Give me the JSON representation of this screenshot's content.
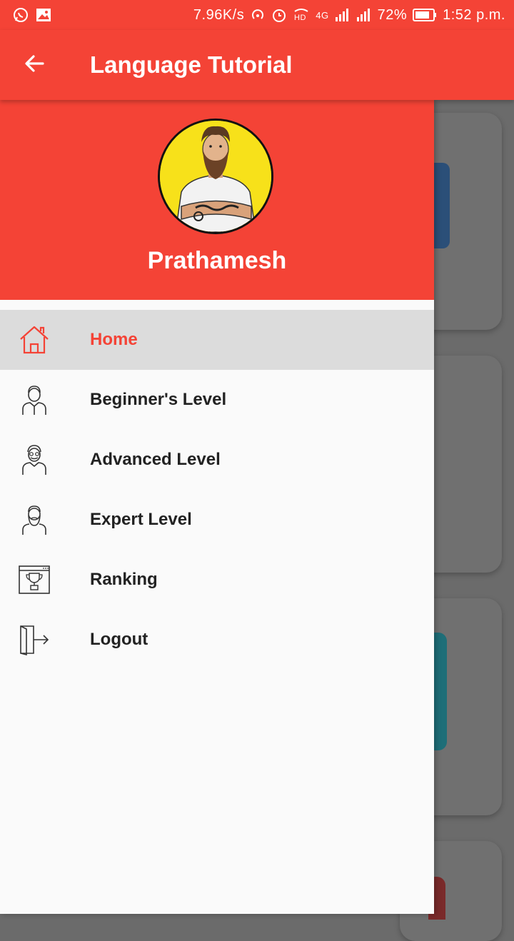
{
  "status_bar": {
    "speed": "7.96K/s",
    "battery": "72%",
    "time": "1:52 p.m.",
    "network": "4G"
  },
  "app_bar": {
    "title": "Language Tutorial",
    "back_icon": "arrow-left-icon"
  },
  "drawer": {
    "user_name": "Prathamesh",
    "items": [
      {
        "label": "Home",
        "icon": "home-icon",
        "active": true
      },
      {
        "label": "Beginner's Level",
        "icon": "beginner-person-icon",
        "active": false
      },
      {
        "label": "Advanced Level",
        "icon": "advanced-person-icon",
        "active": false
      },
      {
        "label": "Expert Level",
        "icon": "expert-person-icon",
        "active": false
      },
      {
        "label": "Ranking",
        "icon": "trophy-icon",
        "active": false
      },
      {
        "label": "Logout",
        "icon": "logout-icon",
        "active": false
      }
    ]
  },
  "colors": {
    "primary": "#f44336",
    "active_bg": "#dcdcdc",
    "scrim": "#6b6b6b"
  }
}
